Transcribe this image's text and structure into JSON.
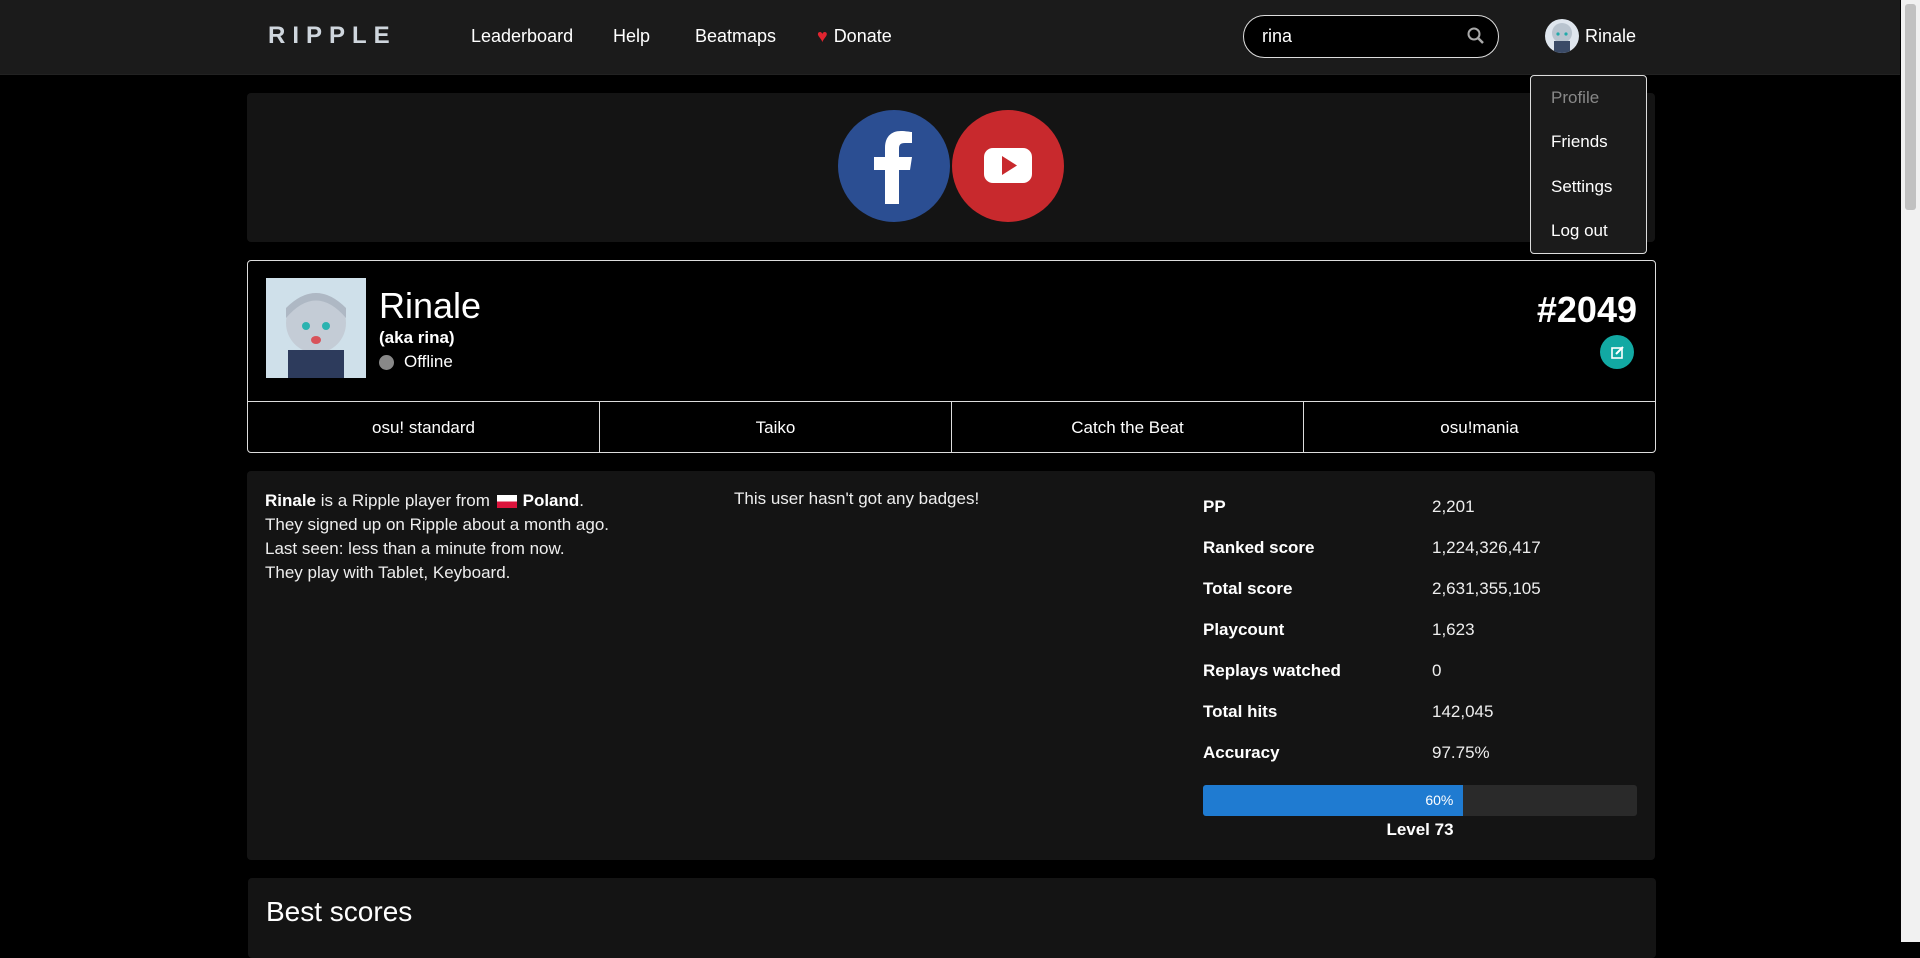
{
  "header": {
    "logo": "RIPPLE",
    "nav": [
      "Leaderboard",
      "Help",
      "Beatmaps",
      "Donate"
    ],
    "search_value": "rina",
    "user_name": "Rinale"
  },
  "user_menu": [
    "Profile",
    "Friends",
    "Settings",
    "Log out"
  ],
  "profile": {
    "name": "Rinale",
    "aka": "(aka rina)",
    "status": "Offline",
    "rank": "#2049",
    "tabs": [
      "osu! standard",
      "Taiko",
      "Catch the Beat",
      "osu!mania"
    ]
  },
  "bio": {
    "line1_name": "Rinale",
    "line1_mid": " is a Ripple player from ",
    "country": "Poland",
    "line1_end": ".",
    "line2": "They signed up on Ripple about a month ago.",
    "line3": "Last seen: less than a minute from now.",
    "line4": "They play with Tablet, Keyboard."
  },
  "badges_text": "This user hasn't got any badges!",
  "stats": [
    {
      "label": "PP",
      "value": "2,201"
    },
    {
      "label": "Ranked score",
      "value": "1,224,326,417"
    },
    {
      "label": "Total score",
      "value": "2,631,355,105"
    },
    {
      "label": "Playcount",
      "value": "1,623"
    },
    {
      "label": "Replays watched",
      "value": "0"
    },
    {
      "label": "Total hits",
      "value": "142,045"
    },
    {
      "label": "Accuracy",
      "value": "97.75%"
    }
  ],
  "level": {
    "progress_percent": 60,
    "progress_label": "60%",
    "label": "Level 73"
  },
  "best_scores_title": "Best scores",
  "colors": {
    "accent": "#1f7bd1",
    "edit": "#12a9a3",
    "facebook": "#2b4e92",
    "youtube": "#c8292d",
    "heart": "#e0242f"
  },
  "icons": [
    "search-icon",
    "heart-icon",
    "facebook-icon",
    "youtube-icon",
    "edit-icon",
    "status-dot-icon",
    "poland-flag-icon"
  ]
}
